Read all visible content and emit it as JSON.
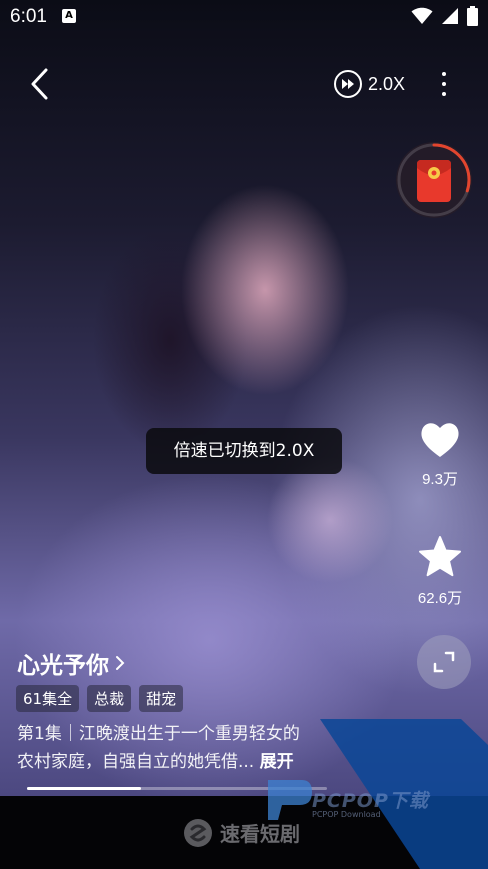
{
  "status_bar": {
    "time": "6:01",
    "notification_icon": "a-icon",
    "wifi_icon": "wifi-icon",
    "signal_icon": "signal-icon",
    "battery_icon": "battery-icon"
  },
  "top_bar": {
    "back_icon": "chevron-left-icon",
    "speed_icon": "fast-forward-icon",
    "speed_label": "2.0X",
    "more_icon": "more-vertical-icon"
  },
  "reward": {
    "icon": "red-packet-icon",
    "progress": 0.3,
    "accent": "#e2452e"
  },
  "toast": {
    "text": "倍速已切换到2.0X"
  },
  "actions": {
    "like": {
      "icon": "heart-icon",
      "count": "9.3万"
    },
    "favorite": {
      "icon": "star-icon",
      "count": "62.6万"
    },
    "fullscreen": {
      "icon": "fullscreen-icon"
    }
  },
  "drama": {
    "title": "心光予你",
    "title_arrow": "chevron-right-icon",
    "tags": [
      "61集全",
      "总裁",
      "甜宠"
    ],
    "description_line1": "第1集｜江晚渡出生于一个重男轻女的",
    "description_line2": "农村家庭，自强自立的她凭借...",
    "expand_label": "展开"
  },
  "progress": {
    "value": 0.38
  },
  "bottom": {
    "brand": "速看短剧",
    "logo_icon": "app-logo-icon"
  },
  "watermark": {
    "text": "PCPOP下载",
    "sub": "PCPOP Download"
  }
}
